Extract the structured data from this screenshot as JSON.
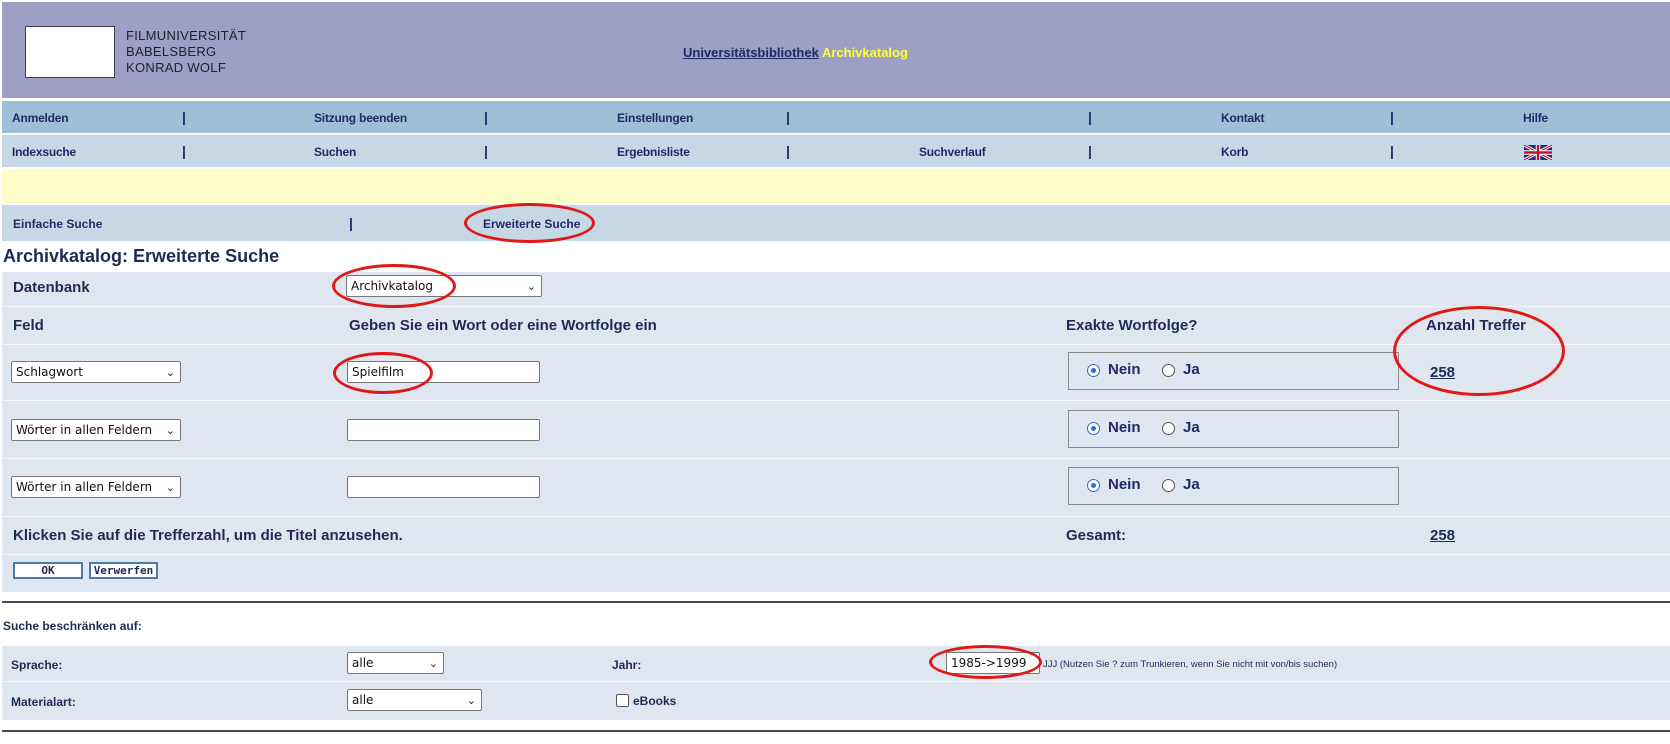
{
  "header": {
    "university_name": [
      "FILMUNIVERSITÄT",
      "BABELSBERG",
      "KONRAD WOLF"
    ],
    "title_library": "Universitätsbibliothek",
    "title_catalog": "Archivkatalog"
  },
  "nav_top": {
    "login": "Anmelden",
    "end_session": "Sitzung beenden",
    "settings": "Einstellungen",
    "contact": "Kontakt",
    "help": "Hilfe",
    "separator": "|"
  },
  "nav_bottom": {
    "index_search": "Indexsuche",
    "search": "Suchen",
    "result_list": "Ergebnisliste",
    "search_history": "Suchverlauf",
    "basket": "Korb",
    "language_icon": "uk-flag-icon"
  },
  "tabs": {
    "simple": "Einfache Suche",
    "advanced": "Erweiterte Suche",
    "separator": "|"
  },
  "page_title": "Archivkatalog: Erweiterte Suche",
  "form": {
    "database_label": "Datenbank",
    "database_value": "Archivkatalog",
    "col_field": "Feld",
    "col_words": "Geben Sie ein Wort oder eine Wortfolge ein",
    "col_exact": "Exakte Wortfolge?",
    "col_hits": "Anzahl Treffer",
    "rows": [
      {
        "field": "Schlagwort",
        "value": "Spielfilm",
        "exact_no": "Nein",
        "exact_yes": "Ja",
        "selected": "Nein",
        "hits": "258"
      },
      {
        "field": "Wörter in allen Feldern",
        "value": "",
        "exact_no": "Nein",
        "exact_yes": "Ja",
        "selected": "Nein",
        "hits": ""
      },
      {
        "field": "Wörter in allen Feldern",
        "value": "",
        "exact_no": "Nein",
        "exact_yes": "Ja",
        "selected": "Nein",
        "hits": ""
      }
    ],
    "instruction": "Klicken Sie auf die Trefferzahl, um die Titel anzusehen.",
    "total_label": "Gesamt:",
    "total_value": "258",
    "ok_button": "OK",
    "reset_button": "Verwerfen"
  },
  "restrict": {
    "title": "Suche beschränken auf:",
    "language_label": "Sprache:",
    "language_value": "alle",
    "year_label": "Jahr:",
    "year_value": "1985->1999",
    "year_hint": "JJJ (Nutzen Sie ? zum Trunkieren, wenn Sie nicht mit von/bis suchen)",
    "material_label": "Materialart:",
    "material_value": "alle",
    "ebooks_label": "eBooks"
  },
  "annotation_color": "#e01818"
}
